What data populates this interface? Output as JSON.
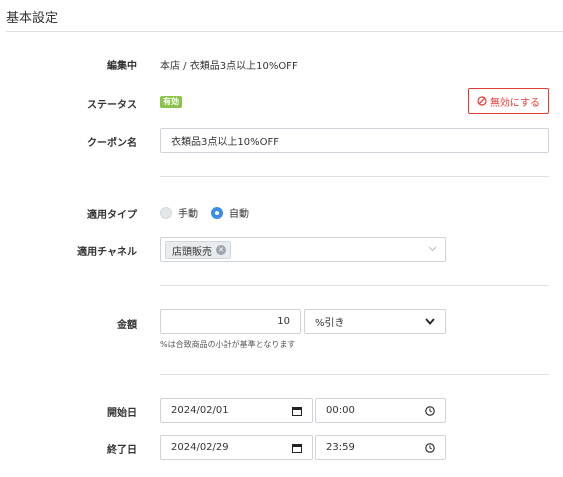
{
  "section": {
    "title": "基本設定"
  },
  "editing": {
    "label": "編集中",
    "value": "本店 / 衣類品3点以上10%OFF"
  },
  "status": {
    "label": "ステータス",
    "badge": "有効",
    "disable_button": "無効にする"
  },
  "coupon_name": {
    "label": "クーポン名",
    "value": "衣類品3点以上10%OFF"
  },
  "apply_type": {
    "label": "適用タイプ",
    "options": [
      "手動",
      "自動"
    ],
    "selected": "自動"
  },
  "channel": {
    "label": "適用チャネル",
    "tags": [
      "店頭販売"
    ]
  },
  "amount": {
    "label": "金額",
    "value": "10",
    "unit": "%引き",
    "help": "%は合致商品の小計が基準となります"
  },
  "start": {
    "label": "開始日",
    "date": "2024/02/01",
    "time": "00:00"
  },
  "end": {
    "label": "終了日",
    "date": "2024/02/29",
    "time": "23:59"
  },
  "colors": {
    "accent": "#3b8ee5",
    "danger": "#e53935",
    "badge": "#8bc34a",
    "border": "#ced4da"
  },
  "icons": [
    "ban-icon",
    "tag-remove-icon",
    "chevron-down-icon",
    "calendar-icon",
    "clock-icon"
  ]
}
